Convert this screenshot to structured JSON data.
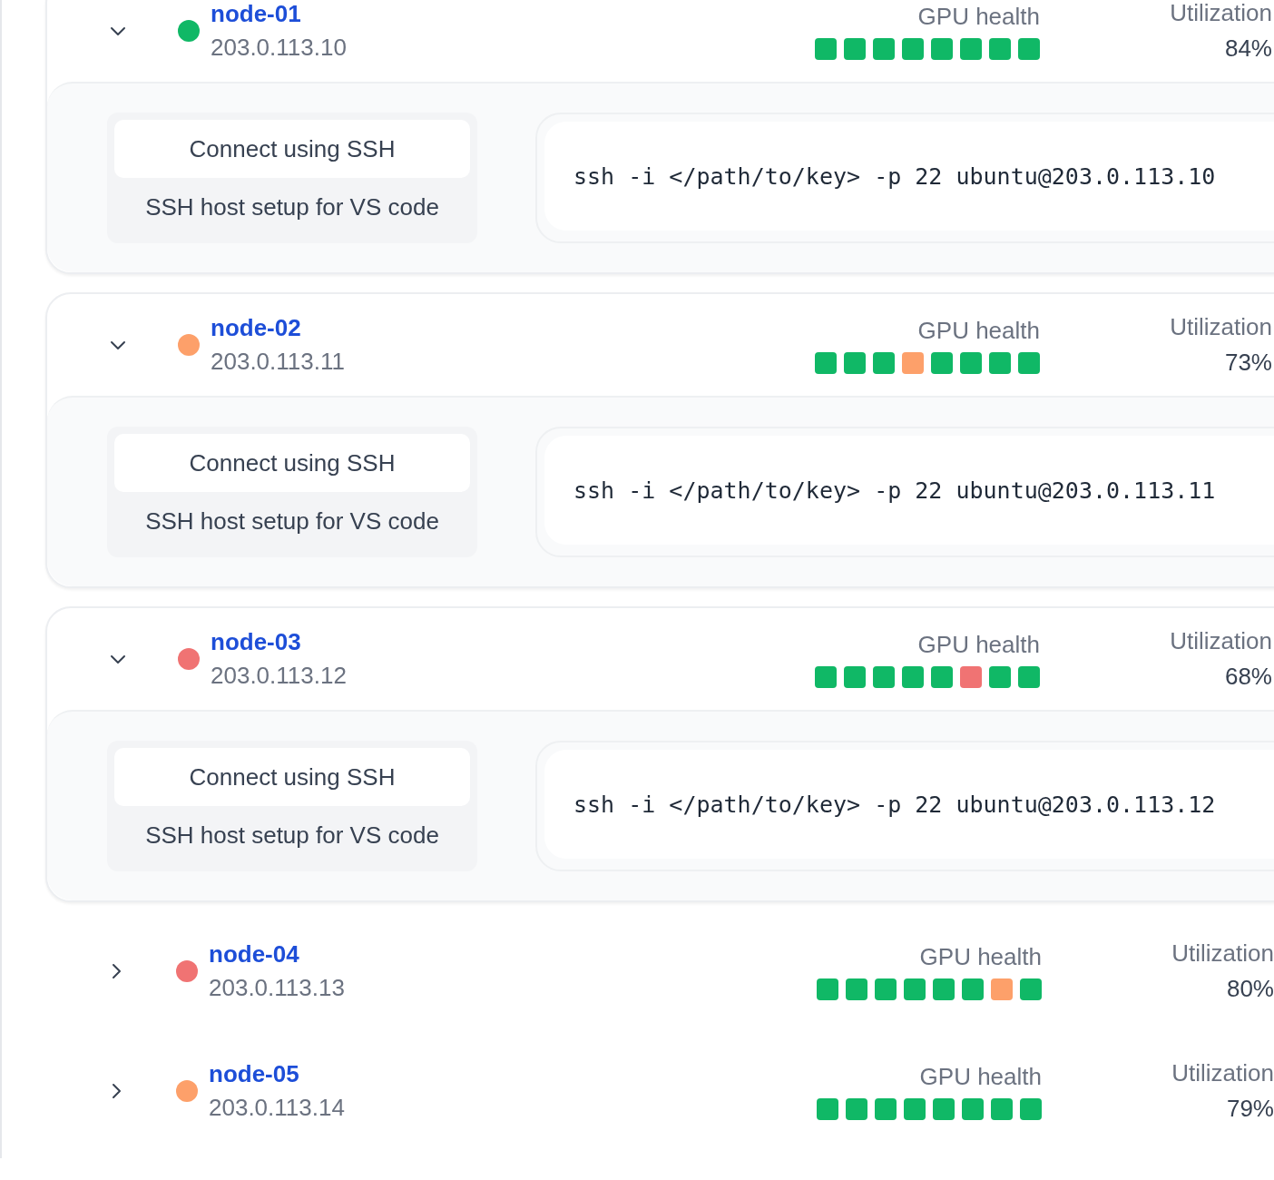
{
  "nodes": [
    {
      "name": "node-01",
      "ip": "203.0.113.10",
      "color": "#10b866",
      "expanded": true,
      "gpu_label": "GPU health",
      "gpu": [
        {
          "color": "#10b866"
        },
        {
          "color": "#10b866"
        },
        {
          "color": "#10b866"
        },
        {
          "color": "#10b866"
        },
        {
          "color": "#10b866"
        },
        {
          "color": "#10b866"
        },
        {
          "color": "#10b866"
        },
        {
          "color": "#10b866"
        }
      ],
      "util_label": "Utilization",
      "utilization": "84%",
      "options": [
        {
          "label": "Connect using SSH",
          "selected": true
        },
        {
          "label": "SSH host setup for VS code",
          "selected": false
        }
      ],
      "command": "ssh -i </path/to/key> -p 22 ubuntu@203.0.113.10"
    },
    {
      "name": "node-02",
      "ip": "203.0.113.11",
      "color": "#fda06a",
      "expanded": true,
      "gpu_label": "GPU health",
      "gpu": [
        {
          "color": "#10b866"
        },
        {
          "color": "#10b866"
        },
        {
          "color": "#10b866"
        },
        {
          "color": "#fda06a"
        },
        {
          "color": "#10b866"
        },
        {
          "color": "#10b866"
        },
        {
          "color": "#10b866"
        },
        {
          "color": "#10b866"
        }
      ],
      "util_label": "Utilization",
      "utilization": "73%",
      "options": [
        {
          "label": "Connect using SSH",
          "selected": true
        },
        {
          "label": "SSH host setup for VS code",
          "selected": false
        }
      ],
      "command": "ssh -i </path/to/key> -p 22 ubuntu@203.0.113.11"
    },
    {
      "name": "node-03",
      "ip": "203.0.113.12",
      "color": "#f07373",
      "expanded": true,
      "gpu_label": "GPU health",
      "gpu": [
        {
          "color": "#10b866"
        },
        {
          "color": "#10b866"
        },
        {
          "color": "#10b866"
        },
        {
          "color": "#10b866"
        },
        {
          "color": "#10b866"
        },
        {
          "color": "#f07373"
        },
        {
          "color": "#10b866"
        },
        {
          "color": "#10b866"
        }
      ],
      "util_label": "Utilization",
      "utilization": "68%",
      "options": [
        {
          "label": "Connect using SSH",
          "selected": true
        },
        {
          "label": "SSH host setup for VS code",
          "selected": false
        }
      ],
      "command": "ssh -i </path/to/key> -p 22 ubuntu@203.0.113.12"
    },
    {
      "name": "node-04",
      "ip": "203.0.113.13",
      "color": "#f07373",
      "expanded": false,
      "gpu_label": "GPU health",
      "gpu": [
        {
          "color": "#10b866"
        },
        {
          "color": "#10b866"
        },
        {
          "color": "#10b866"
        },
        {
          "color": "#10b866"
        },
        {
          "color": "#10b866"
        },
        {
          "color": "#10b866"
        },
        {
          "color": "#fda06a"
        },
        {
          "color": "#10b866"
        }
      ],
      "util_label": "Utilization",
      "utilization": "80%"
    },
    {
      "name": "node-05",
      "ip": "203.0.113.14",
      "color": "#fda06a",
      "expanded": false,
      "gpu_label": "GPU health",
      "gpu": [
        {
          "color": "#10b866"
        },
        {
          "color": "#10b866"
        },
        {
          "color": "#10b866"
        },
        {
          "color": "#10b866"
        },
        {
          "color": "#10b866"
        },
        {
          "color": "#10b866"
        },
        {
          "color": "#10b866"
        },
        {
          "color": "#10b866"
        }
      ],
      "util_label": "Utilization",
      "utilization": "79%"
    }
  ]
}
